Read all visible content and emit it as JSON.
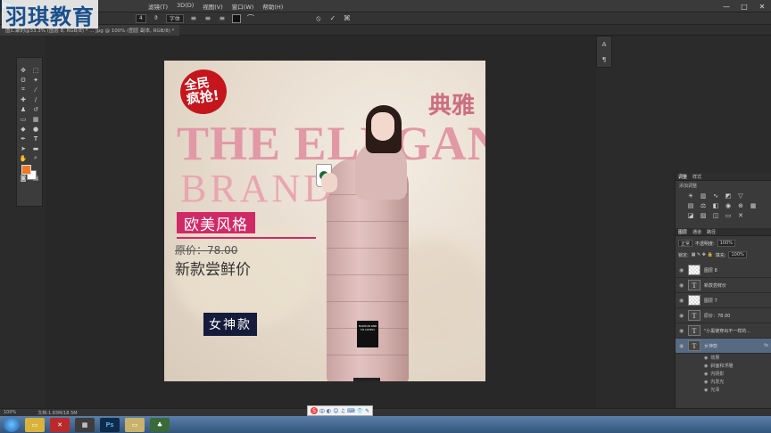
{
  "watermark": "羽琪教育",
  "app": {
    "logo": "Ps"
  },
  "menu": [
    "滤镜(T)",
    "3D(D)",
    "视图(V)",
    "窗口(W)",
    "帮助(H)"
  ],
  "window_buttons": [
    "—",
    "□",
    "✕"
  ],
  "options": {
    "size": "4",
    "style": "字体",
    "cancel": "⦸",
    "commit": "✓"
  },
  "doc_tab": "图汇聚的@33.3% (图层 8, RGB/8) * ... jpg @ 100% (图层 副本, RGB/8) *",
  "canvas": {
    "badge_line1": "全民",
    "badge_line2": "疯抢!",
    "elegant_cn": "典雅",
    "headline1": "THE ELEGANT",
    "headline2": "BRAND",
    "style_label": "欧美风格",
    "orig_price": "原价：78.00",
    "new_price": "新款尝鲜价",
    "goddess": "女神款",
    "coat_label": "FASHION ONE TO LOVELY"
  },
  "panel_strip": [
    "A",
    "¶"
  ],
  "panels": {
    "adj_tabs": [
      "调整",
      "样式"
    ],
    "adj_title": "添加调整",
    "layer_tabs": [
      "图层",
      "通道",
      "路径"
    ],
    "blend_mode": "正常",
    "opacity_label": "不透明度:",
    "opacity": "100%",
    "lock_label": "锁定:",
    "fill_label": "填充:",
    "fill": "100%",
    "layers": [
      {
        "name": "图层 8",
        "type": "pixel"
      },
      {
        "name": "新款尝鲜价",
        "type": "text"
      },
      {
        "name": "图层 7",
        "type": "pixel"
      },
      {
        "name": "原价：78.00",
        "type": "text"
      },
      {
        "name": "\"小黑链穿出不一样的...",
        "type": "text"
      },
      {
        "name": "女神款",
        "type": "text",
        "selected": true
      }
    ],
    "effects_label": "效果",
    "effects": [
      "斜面和浮雕",
      "内阴影",
      "内发光",
      "光泽"
    ],
    "fx": "fx"
  },
  "status": {
    "zoom": "100%",
    "doc": "文档:1.83M/18.5M"
  },
  "ime": {
    "logo": "S",
    "mode": "中"
  }
}
